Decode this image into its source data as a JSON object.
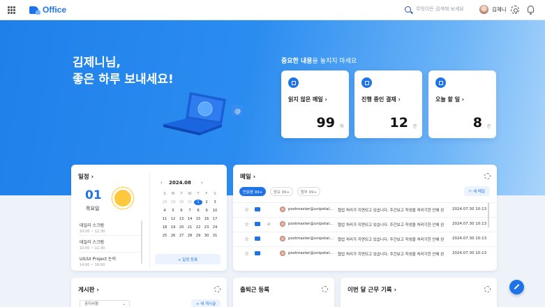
{
  "header": {
    "app_name": "Office",
    "search_placeholder": "무엇이든 검색해 보세요",
    "user_name": "김제니"
  },
  "hero": {
    "greeting_line1": "김제니님,",
    "greeting_line2": "좋은 하루 보내세요!",
    "important_bold": "중요한 내용",
    "important_rest": "을 놓치지 마세요"
  },
  "stats": [
    {
      "label": "읽지 않은 메일",
      "value": "99",
      "unit": "개"
    },
    {
      "label": "진행 중인 결재",
      "value": "12",
      "unit": "건"
    },
    {
      "label": "오늘 할 일",
      "value": "8",
      "unit": "건"
    }
  ],
  "schedule": {
    "title": "일정",
    "day": "01",
    "weekday": "목요일",
    "items": [
      {
        "title": "데일리 스크럼",
        "time": "10:00 ~ 11:30"
      },
      {
        "title": "데일리 스크럼",
        "time": "10:00 ~ 11:30"
      },
      {
        "title": "UX/UI Project 논의",
        "time": "14:00 ~ 16:00"
      }
    ],
    "calendar_title": "2024.08",
    "weekdays": [
      "S",
      "M",
      "T",
      "W",
      "T",
      "F",
      "S"
    ],
    "weeks": [
      [
        "28",
        "29",
        "30",
        "31",
        "1",
        "2",
        "3"
      ],
      [
        "4",
        "5",
        "6",
        "7",
        "8",
        "9",
        "10"
      ],
      [
        "11",
        "12",
        "13",
        "14",
        "15",
        "16",
        "17"
      ],
      [
        "18",
        "19",
        "20",
        "21",
        "22",
        "23",
        "24"
      ],
      [
        "25",
        "26",
        "27",
        "28",
        "29",
        "30",
        "31"
      ]
    ],
    "today": "1",
    "add_button": "+ 일정 등록"
  },
  "mail": {
    "title": "메일",
    "tabs": [
      "안읽음 99+",
      "중요 99+",
      "첨부 99+"
    ],
    "new_button": "새 메일",
    "rows": [
      {
        "from": "postmaster@unipotal...",
        "subject": "협업 처리가 지연되고 있습니다. 주간보고 작성을 처리기한 안에 완...",
        "date": "2024.07.30 10:13",
        "attach": false
      },
      {
        "from": "postmaster@unipotal...",
        "subject": "협업 처리가 지연되고 있습니다. 주간보고 작성을 처리기한 안에 완...",
        "date": "2024.07.30 10:13",
        "attach": true
      },
      {
        "from": "postmaster@unipotal...",
        "subject": "협업 처리가 지연되고 있습니다. 주간보고 작성을 처리기한 안에 완...",
        "date": "2024.07.30 10:13",
        "attach": false
      },
      {
        "from": "postmaster@unipotal...",
        "subject": "협업 처리가 지연되고 있습니다. 주간보고 작성을 처리기한 안에 완...",
        "date": "2024.07.30 10:13",
        "attach": false
      }
    ]
  },
  "board": {
    "title": "게시판",
    "select_value": "공지사항",
    "write_button": "+ 새 게시글"
  },
  "attendance": {
    "title": "출퇴근 등록"
  },
  "worklog": {
    "title": "이번 달 근무 기록"
  }
}
